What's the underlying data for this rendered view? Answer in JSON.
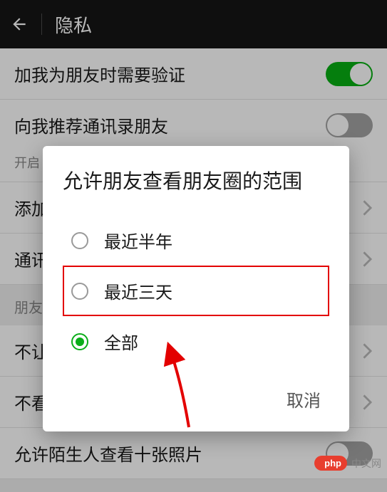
{
  "header": {
    "title": "隐私"
  },
  "rows": {
    "verify": {
      "label": "加我为朋友时需要验证",
      "toggle": "on"
    },
    "recommend": {
      "label": "向我推荐通讯录朋友",
      "toggle": "off",
      "sub": "开启"
    },
    "addway": {
      "label": "添加"
    },
    "contacts": {
      "label": "通讯"
    },
    "section": {
      "label": "朋友"
    },
    "block1": {
      "label": "不让"
    },
    "block2": {
      "label": "不看"
    },
    "tenphotos": {
      "label": "允许陌生人查看十张照片",
      "toggle": "off"
    }
  },
  "dialog": {
    "title": "允许朋友查看朋友圈的范围",
    "options": {
      "halfyear": "最近半年",
      "threedays": "最近三天",
      "all": "全部"
    },
    "cancel": "取消"
  },
  "watermark": {
    "badge": "php",
    "text": "中文网"
  }
}
